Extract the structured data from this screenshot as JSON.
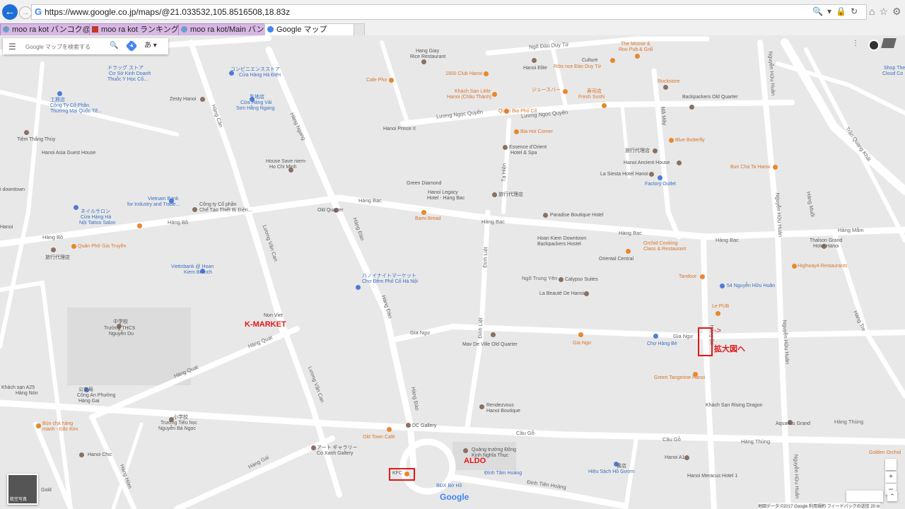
{
  "browser": {
    "url": "https://www.google.co.jp/maps/@21.033532,105.8516508,18.83z",
    "tabs": [
      {
        "label": "moo ra kot バンコク@タイ在住..."
      },
      {
        "label": "moo ra kot ランキングポイント -..."
      },
      {
        "label": "moo ra kot/Main バンコク@タ..."
      },
      {
        "label": "Google マップ"
      }
    ]
  },
  "search": {
    "placeholder": "Google マップを検索する",
    "ime": "あ"
  },
  "colors": {
    "road": "#ffffff",
    "background": "#e8e8e8",
    "annotation": "#e01818",
    "poi_food": "#e6882e",
    "poi_general": "#8d6e63",
    "poi_shop": "#4f7bd8"
  },
  "roads": {
    "hang_bac": "Hàng Bạc",
    "hang_bo": "Hàng Bồ",
    "gia_ngu": "Gia Ngư",
    "cau_go": "Cầu Gỗ",
    "hang_thung": "Hàng Thùng",
    "hang_dao": "Hàng Đào",
    "hang_can": "Hàng Cân",
    "hang_ngang": "Hàng Ngang",
    "luong_van_can": "Lương Văn Can",
    "hang_quat": "Hàng Quạt",
    "dinh_liet": "Đinh Liệt",
    "ta_hien": "Tạ Hiện",
    "ma_may": "Mã Mây",
    "luong_ngoc_quyen": "Lương Ngọc Quyến",
    "hang_be": "Hàng Bè",
    "nguyen_huu_huan": "Nguyễn Hữu Huân",
    "hang_mam": "Hàng Mắm",
    "dao_duy_tu": "Ngõ Đào Duy Tứ",
    "dinh_tien_hoang": "Đinh Tiên Hoàng",
    "tran_quang_khai": "Trần Quang Khải",
    "hang_gai": "Hàng Gai",
    "hang_hom": "Hàng Hòm",
    "hang_tre": "Hàng Tre",
    "hang_muoi": "Hàng Muối",
    "ngo_trung_yen": "Ngõ Trung Yên"
  },
  "places": {
    "hang_giay": "Hang Giay",
    "rice_restaurant": "Rice Restaurant",
    "club_1900": "1900 Club Hanoi",
    "hanoi_elite": "Hanoi Elite",
    "culture": "Culture",
    "ribs": "Ribs nce Đào Duy Tứ",
    "moose": "The Moose &",
    "roo_pub": "Roo Pub & Grill",
    "cafe_pho": "Cafe Pho",
    "khach_san": "Khách Sạn Little",
    "hanoi_chau": "Hanoi (Châu Thành)",
    "juice_bar": "ジュースバー",
    "juice_bar2": "Fresh Sushi",
    "sushi_jp": "寿司店",
    "rockstore": "Rockstore",
    "bia_pho_co": "Quán Bia Phố Cổ",
    "bia_hoi": "Bia Hoi Corner",
    "backpackers_old": "Backpackers Old Quarter",
    "hanoi_prince": "Hanoi Prince II",
    "essence": "Essence d'Orient",
    "essence2": "Hotel & Spa",
    "blue_butterfly": "Blue Butterfly",
    "travel_agency": "旅行代理店",
    "hanoi_ancient": "Hanoi Ancient House",
    "la_siesta": "La Siesta Hotel Hanoi",
    "factory_outlet": "Factory Outlet",
    "bun_cha_ta": "Bun Cha Ta Hanoi",
    "green_diamond": "Green Diamond",
    "legacy": "Hanoi Legacy",
    "legacy2": "Hotel - Hang Bac",
    "travel_agency2": "旅行代理店",
    "paradise": "Paradise Boutique Hotel",
    "old_quarter": "Old Quarter",
    "bami_bread": "Bami Bread",
    "hoan_kiem_downtown": "Hoan Kiem Downtown",
    "hoan_kiem_downtown2": "Backpackers Hostel",
    "orchid": "Orchid Cooking",
    "orchid2": "Class & Restaurant",
    "oriental_central": "Oriental Central",
    "thalson": "Thalson Grand",
    "thalson2": "Hotel Hanoi",
    "highway4": "Highway4 Restaurants",
    "tandoor": "Tandoor",
    "calypso": "Calypso Suites",
    "la_beaute": "La Beauté De Hanoi",
    "nguyen_huu_huan54": "54 Nguyễn Hữu Huân",
    "le_pub": "Le PUB",
    "market_jp": "ハノイナイトマーケット",
    "market_vi": "Chợ Đêm Phố Cổ Hà Nội",
    "mav_de_ville": "Mav De Ville Old Quarter",
    "gia_ngu_pin": "Gia Ngư",
    "cho_hang_be": "Chợ Hàng Bè",
    "green_tangerine": "Green Tangerine Hanoi",
    "non_viet": "Non Viet",
    "junior_school_jp": "中学校",
    "junior_school": "Trường THCS",
    "junior_school2": "Nguyễn Du",
    "rendezvous": "Rendezvous",
    "rendezvous2": "Hanoi Boutique",
    "rising_dragon": "Khách Sạn Rising Dragon",
    "aquarius": "Aquarius Grand",
    "dc_gallery": "DC Gallery",
    "old_town_cafe": "Old Town Café",
    "art_gallery_jp": "アート ギャラリー",
    "art_gallery": "Co Xanh Gallery",
    "dong_kinh": "Quảng trường Đông",
    "dong_kinh2": "Kinh Nghĩa Thục",
    "dinh_tam_hoang": "Đình Tâm Hoàng",
    "book_store_jp": "書店",
    "hieu_sach": "Hiệu Sách Hồ Gươm",
    "hanoi_a1": "Hanoi A1",
    "meracus": "Hanoi Meracus Hotel 1",
    "bdx": "BĐX Bờ Hồ",
    "kfc": "KFC",
    "drug_store_jp": "ドラッグ ストア",
    "drug_store": "Cơ Sở Kinh Doanh",
    "drug_store2": "Thuốc Y Học Cổ...",
    "convenience_jp": "コンビニエンスストア",
    "convenience": "Cửa Hàng Hà Điện",
    "factory_jp": "工務店",
    "factory": "Công Ty Cổ Phần",
    "factory2": "Thương Mại Quốc Tế...",
    "zesty": "Zesty Hanoi",
    "fabric_jp": "生地店",
    "fabric": "Cửa Hàng Vải",
    "fabric2": "Sơn Hằng Ngang",
    "tiem_thang": "Tiệm Thắng Thúy",
    "asia_guesthouse": "Hanoi Asia Guest House",
    "house_save": "House Save niem-",
    "house_save2": "Ho Chi Minh",
    "vietnam_bank": "Vietnam Bank",
    "vietnam_bank2": "for Industry and Trade...",
    "nail_jp": "ネイルサロン",
    "nail": "Cửa Hàng Hà",
    "nail2": "Nội Tattoo Salon",
    "cong_ty": "Công ty Cổ phần",
    "cong_ty2": "Chế Tạo Thiết Bị Điện...",
    "gia_truyen": "Quán Phở Gia Truyền",
    "travel_agency3": "旅行代理店",
    "vietinbank": "Vietinbank @ Hoan",
    "vietinbank2": "Kiem Branch",
    "police_jp": "公安局",
    "police": "Công An Phường",
    "police2": "Hàng Gai",
    "elementary_jp": "小学校",
    "elementary": "Trường Tiểu học",
    "elementary2": "Nguyễn Bá Ngọc",
    "bun_cha_hang": "Bún chả hàng",
    "bun_cha_hang2": "mành - Đắc Kim",
    "khach_san_a25": "Khách sạn A25",
    "hang_non": "Hàng Nón",
    "hanoi_chic": "Hanoi Chic",
    "golden_orchid": "Golden Orchid",
    "shop_theo": "Shop Theo",
    "shop_theo2": "Cloud Co",
    "hanoi_gold": "Gold",
    "hanoi_downtown": "i downtown",
    "hanoi_left": "Hanoi",
    "hang_muoi_pin": "Hàng Muối"
  },
  "annotations": {
    "k_market": "K-MARKET",
    "aldo": "ALDO",
    "arrow": "->",
    "to_zoom": "拡大図へ"
  },
  "map_controls": {
    "satellite": "航空写真",
    "google": "Google",
    "attribution": "地図データ ©2017 Google   利用規約   フィードバックの送信   20 m"
  }
}
